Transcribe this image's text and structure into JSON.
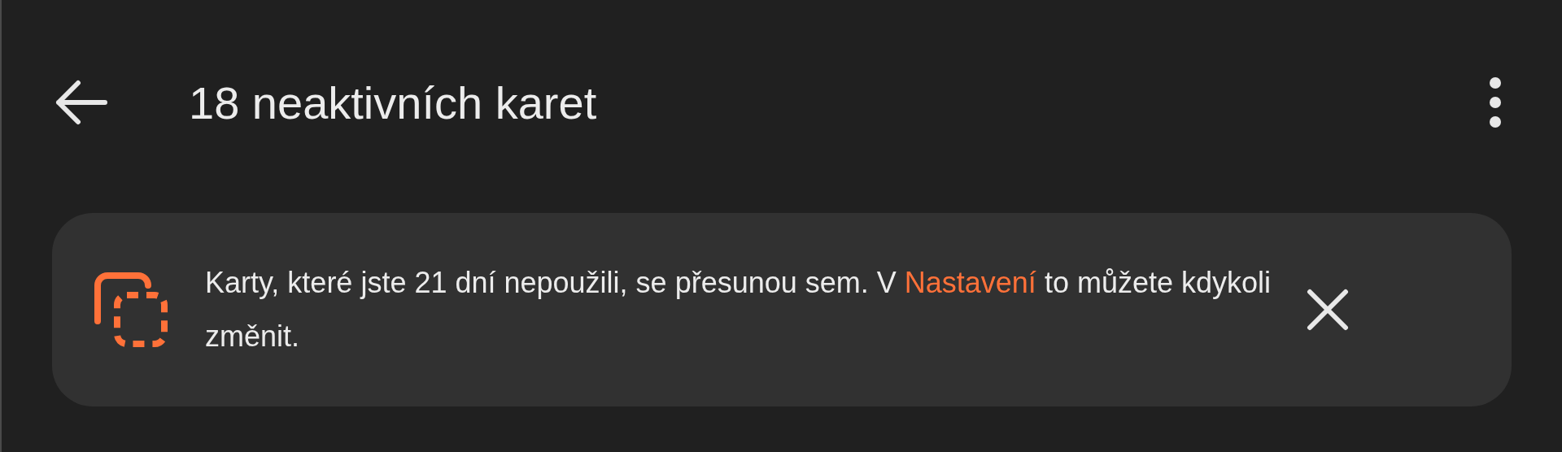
{
  "header": {
    "title": "18 neaktivních karet"
  },
  "banner": {
    "text_before": "Karty, které jste 21 dní nepoužili, se přesunou sem. V ",
    "link": "Nastavení",
    "text_after": " to můžete kdykoli změnit."
  }
}
